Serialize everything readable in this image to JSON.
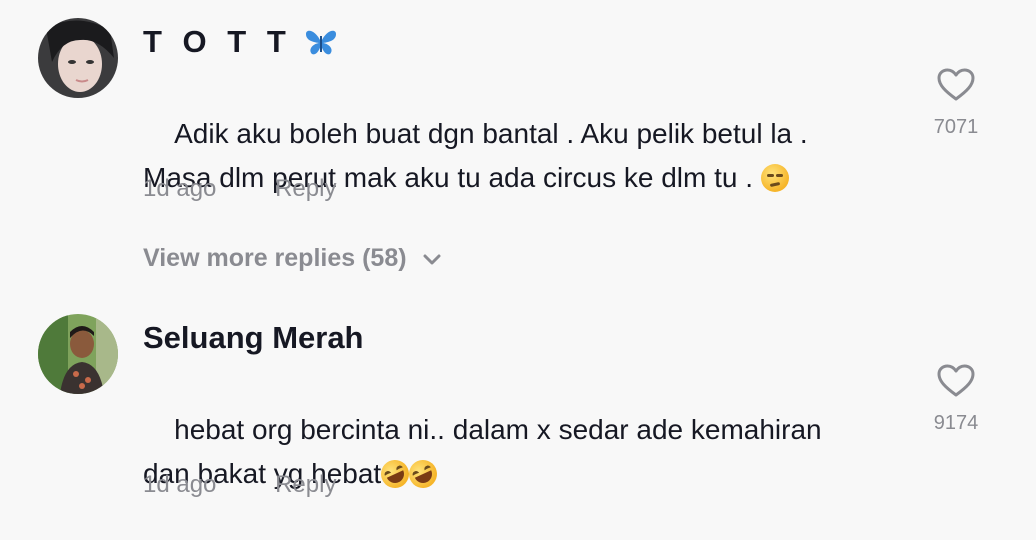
{
  "comments": [
    {
      "username": "T O T T",
      "username_emoji": "butterfly-icon",
      "text": "Adik aku boleh buat dgn bantal . Aku pelik betul la .\nMasa dlm perut mak aku tu ada circus ke dlm tu . ",
      "text_emoji": "unamused-face-emoji",
      "age": "1d ago",
      "reply_label": "Reply",
      "likes": "7071"
    },
    {
      "username": "Seluang Merah",
      "text": "hebat org bercinta ni.. dalam x sedar ade kemahiran\ndan bakat yg hebat",
      "text_emoji": "rolling-on-floor-laughing-emoji",
      "age": "1d ago",
      "reply_label": "Reply",
      "likes": "9174"
    }
  ],
  "view_more_replies": "View more replies (58)",
  "colors": {
    "background": "#f8f8f8",
    "primary_text": "#161823",
    "secondary_text": "#8a8b91",
    "butterfly": "#3a8dde"
  }
}
